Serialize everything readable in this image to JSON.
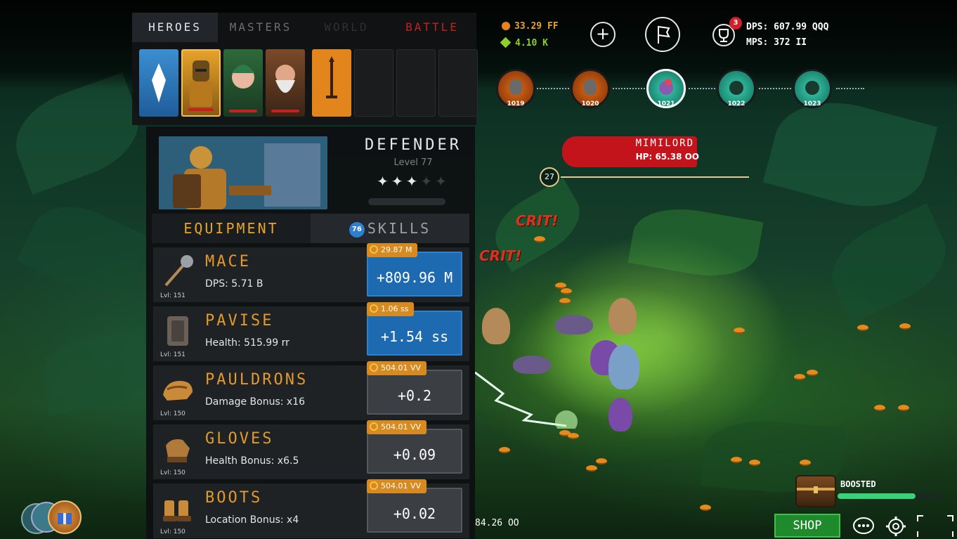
{
  "tabs": [
    {
      "label": "HEROES",
      "state": "active"
    },
    {
      "label": "MASTERS",
      "state": "normal"
    },
    {
      "label": "WORLD",
      "state": "disabled"
    },
    {
      "label": "BATTLE",
      "state": "alert"
    }
  ],
  "hud": {
    "gold": "33.29 FF",
    "gems": "4.10 K",
    "dps": "DPS: 607.99 QQQ",
    "mps": "MPS: 372 II",
    "trophy_badge": "3"
  },
  "stages": [
    "1019",
    "1020",
    "1021",
    "1022",
    "1023"
  ],
  "boss": {
    "name": "MIMILORD",
    "hp": "HP: 65.38 OO",
    "timer": "27"
  },
  "crits": [
    "CRIT!",
    "CRIT!"
  ],
  "hero": {
    "name": "DEFENDER",
    "level": "Level 77",
    "stars_filled": 3,
    "stars_total": 5
  },
  "hero_tabs": {
    "equipment": "EQUIPMENT",
    "skills": "SKILLS",
    "skills_badge": "76"
  },
  "items": [
    {
      "name": "MACE",
      "stat": "DPS: 5.71 B",
      "lvl": "Lvl: 151",
      "cost": "29.87 M",
      "value": "+809.96 M",
      "affordable": true,
      "icon": "mace-icon"
    },
    {
      "name": "PAVISE",
      "stat": "Health: 515.99 rr",
      "lvl": "Lvl: 151",
      "cost": "1.06 ss",
      "value": "+1.54 ss",
      "affordable": true,
      "icon": "shield-icon"
    },
    {
      "name": "PAULDRONS",
      "stat": "Damage Bonus: x16",
      "lvl": "Lvl: 150",
      "cost": "504.01 VV",
      "value": "+0.2",
      "affordable": false,
      "icon": "pauldrons-icon"
    },
    {
      "name": "GLOVES",
      "stat": "Health Bonus: x6.5",
      "lvl": "Lvl: 150",
      "cost": "504.01 VV",
      "value": "+0.09",
      "affordable": false,
      "icon": "gloves-icon"
    },
    {
      "name": "BOOTS",
      "stat": "Location Bonus: x4",
      "lvl": "Lvl: 150",
      "cost": "504.01 VV",
      "value": "+0.02",
      "affordable": false,
      "icon": "boots-icon"
    }
  ],
  "bottom_partial": "84.26 OO",
  "boost": {
    "label": "BOOSTED",
    "progress": 0.75
  },
  "shop_label": "SHOP",
  "colors": {
    "accent_orange": "#e39a2a",
    "buy_blue": "#1d6ab0",
    "boss_red": "#c3141c",
    "shop_green": "#1e8a2c"
  }
}
